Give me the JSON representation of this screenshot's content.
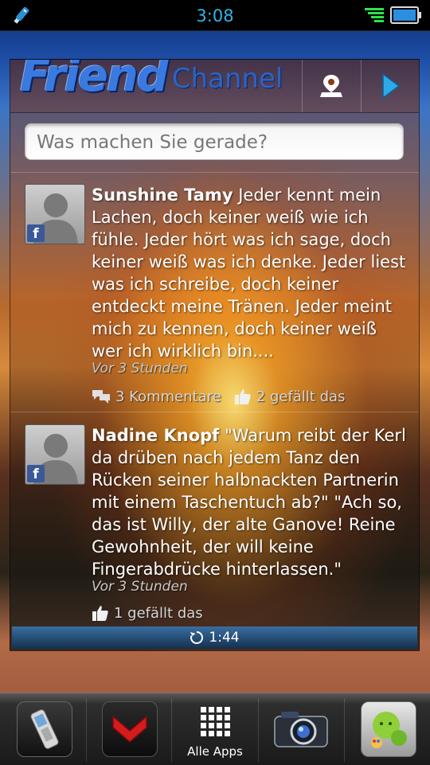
{
  "status_bar": {
    "time": "3:08",
    "icons": [
      "usb-debug-icon",
      "signal-icon",
      "battery-icon"
    ]
  },
  "widget": {
    "logo": {
      "friend": "Friend",
      "channel": "Channel"
    },
    "header_buttons": [
      "location-pin-icon",
      "next-arrow-icon"
    ],
    "status_input": {
      "placeholder": "Was machen Sie gerade?"
    },
    "posts": [
      {
        "author": "Sunshine Tamy",
        "text": "Jeder kennt mein Lachen, doch keiner weiß wie ich fühle. Jeder hört was ich sage, doch keiner weiß was ich denke. Jeder liest was ich schreibe, doch keiner entdeckt meine Tränen. Jeder meint mich zu kennen, doch keiner weiß wer ich wirklich bin....",
        "time": "Vor 3 Stunden",
        "comments": "3 Kommentare",
        "likes": "2 gefällt das"
      },
      {
        "author": "Nadine Knopf",
        "text": "\"Warum reibt der Kerl da drüben nach jedem Tanz den Rücken seiner halbnackten Partnerin mit einem Taschentuch ab?\" \"Ach so, das ist Willy, der alte Ganove! Reine Gewohnheit, der will keine Fingerabdrücke hinterlassen.\"",
        "time": "Vor 3 Stunden",
        "likes": "1 gefällt das"
      }
    ],
    "refresh": {
      "label": "1:44"
    }
  },
  "dock": {
    "items": [
      {
        "name": "phone-app-icon"
      },
      {
        "name": "red-app-icon"
      },
      {
        "name": "all-apps-grid-icon",
        "label": "Alle Apps"
      },
      {
        "name": "camera-app-icon"
      },
      {
        "name": "chat-app-icon"
      }
    ]
  },
  "colors": {
    "clock": "#33b5e5",
    "facebook": "#3b5998",
    "logo_blue": "#3a7ae0"
  }
}
